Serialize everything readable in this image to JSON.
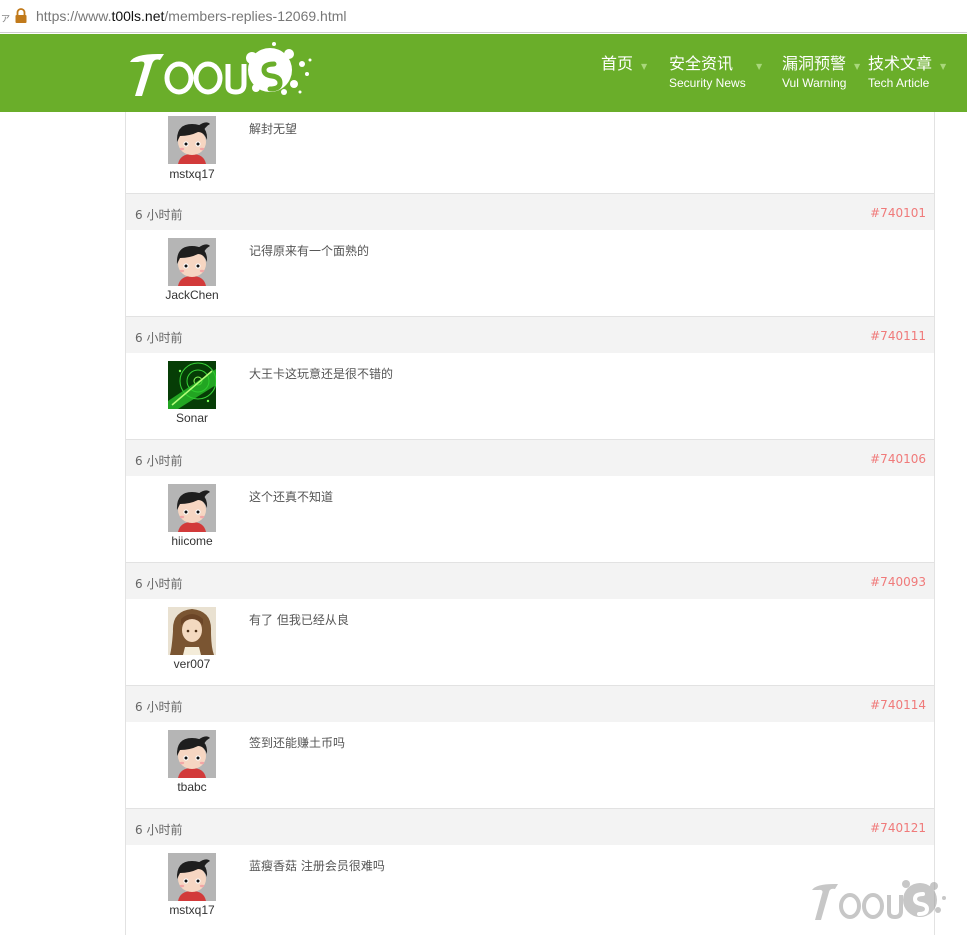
{
  "browser": {
    "url_prefix": "https://www.",
    "url_host": "t00ls.net",
    "url_path": "/members-replies-12069.html",
    "edge_char": "ァ"
  },
  "site": {
    "brand_color": "#6aae2a",
    "logo_text": "TOOLS"
  },
  "nav": [
    {
      "main": "首页",
      "sub": ""
    },
    {
      "main": "安全资讯",
      "sub": "Security News"
    },
    {
      "main": "漏洞预警",
      "sub": "Vul Warning"
    },
    {
      "main": "技术文章",
      "sub": "Tech Article"
    }
  ],
  "first_reply": {
    "user": "mstxq17",
    "avatar": "boy",
    "content": "解封无望"
  },
  "replies": [
    {
      "time": "6 小时前",
      "id": "#740101",
      "user": "JackChen",
      "avatar": "boy",
      "content": "记得原来有一个面熟的"
    },
    {
      "time": "6 小时前",
      "id": "#740111",
      "user": "Sonar",
      "avatar": "radar",
      "content": "大王卡这玩意还是很不错的"
    },
    {
      "time": "6 小时前",
      "id": "#740106",
      "user": "hiicome",
      "avatar": "boy",
      "content": "这个还真不知道"
    },
    {
      "time": "6 小时前",
      "id": "#740093",
      "user": "ver007",
      "avatar": "girl",
      "content": "有了 但我已经从良"
    },
    {
      "time": "6 小时前",
      "id": "#740114",
      "user": "tbabc",
      "avatar": "boy",
      "content": "签到还能赚土币吗"
    },
    {
      "time": "6 小时前",
      "id": "#740121",
      "user": "mstxq17",
      "avatar": "boy",
      "content": "蓝瘦香菇 注册会员很难吗"
    }
  ]
}
